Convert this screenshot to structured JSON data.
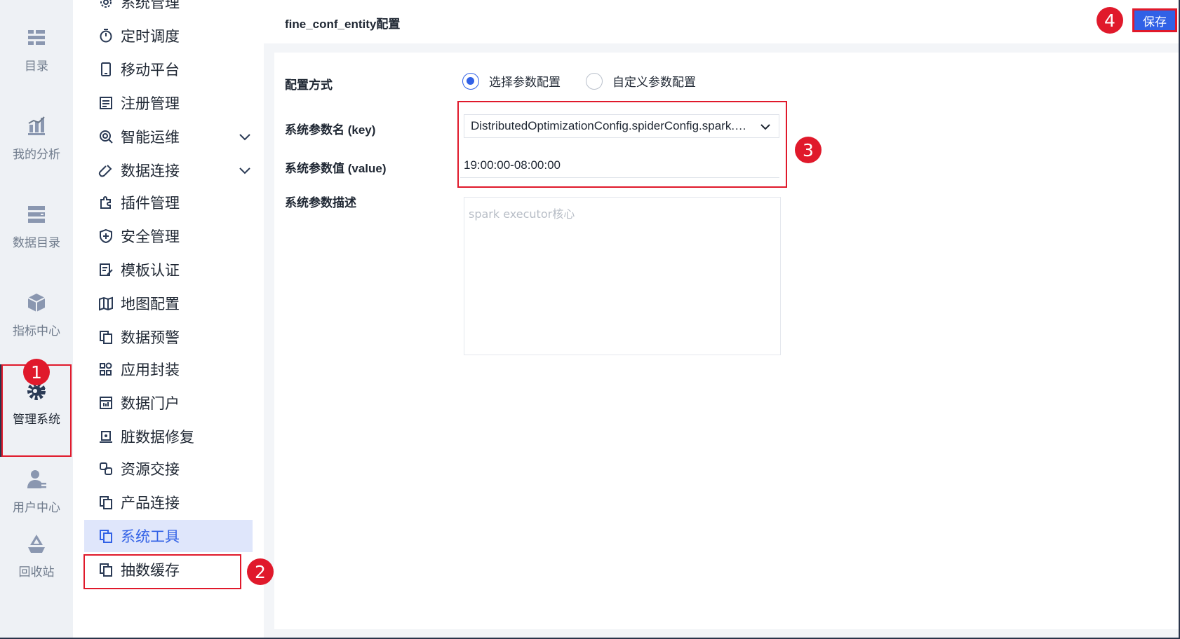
{
  "rail": {
    "items": [
      {
        "label": "目录",
        "icon": "catalog-icon"
      },
      {
        "label": "我的分析",
        "icon": "analysis-chart-icon"
      },
      {
        "label": "数据目录",
        "icon": "data-catalog-icon"
      },
      {
        "label": "指标中心",
        "icon": "metric-cube-icon"
      },
      {
        "label": "管理系统",
        "icon": "manage-gear-icon",
        "active": true
      },
      {
        "label": "用户中心",
        "icon": "user-icon"
      },
      {
        "label": "回收站",
        "icon": "recycle-icon"
      }
    ]
  },
  "menu": {
    "items": [
      {
        "label": "系统管理",
        "icon": "settings-icon"
      },
      {
        "label": "定时调度",
        "icon": "timer-icon"
      },
      {
        "label": "移动平台",
        "icon": "mobile-icon"
      },
      {
        "label": "注册管理",
        "icon": "register-icon"
      },
      {
        "label": "智能运维",
        "icon": "ops-icon",
        "expandable": true
      },
      {
        "label": "数据连接",
        "icon": "link-icon",
        "expandable": true
      },
      {
        "label": "插件管理",
        "icon": "plugin-icon"
      },
      {
        "label": "安全管理",
        "icon": "shield-icon"
      },
      {
        "label": "模板认证",
        "icon": "template-icon"
      },
      {
        "label": "地图配置",
        "icon": "map-icon"
      },
      {
        "label": "数据预警",
        "icon": "copy-icon"
      },
      {
        "label": "应用封装",
        "icon": "app-grid-icon"
      },
      {
        "label": "数据门户",
        "icon": "portal-icon"
      },
      {
        "label": "脏数据修复",
        "icon": "repair-icon"
      },
      {
        "label": "资源交接",
        "icon": "handover-icon"
      },
      {
        "label": "产品连接",
        "icon": "copy-icon"
      },
      {
        "label": "系统工具",
        "icon": "copy-icon",
        "active": true
      },
      {
        "label": "抽数缓存",
        "icon": "copy-icon"
      }
    ]
  },
  "header": {
    "title": "fine_conf_entity配置",
    "save_label": "保存"
  },
  "form": {
    "config_mode_label": "配置方式",
    "mode_options": [
      "选择参数配置",
      "自定义参数配置"
    ],
    "selected_mode": "选择参数配置",
    "key_label": "系统参数名 (key)",
    "key_value": "DistributedOptimizationConfig.spiderConfig.spark.executor.cores",
    "value_label": "系统参数值 (value)",
    "value_value": "19:00:00-08:00:00",
    "desc_label": "系统参数描述",
    "desc_placeholder": "spark executor核心"
  },
  "annotations": [
    "1",
    "2",
    "3",
    "4"
  ],
  "colors": {
    "accent": "#3161e6",
    "highlight": "#e0192b",
    "active_menu_bg": "#dfe6fb"
  }
}
